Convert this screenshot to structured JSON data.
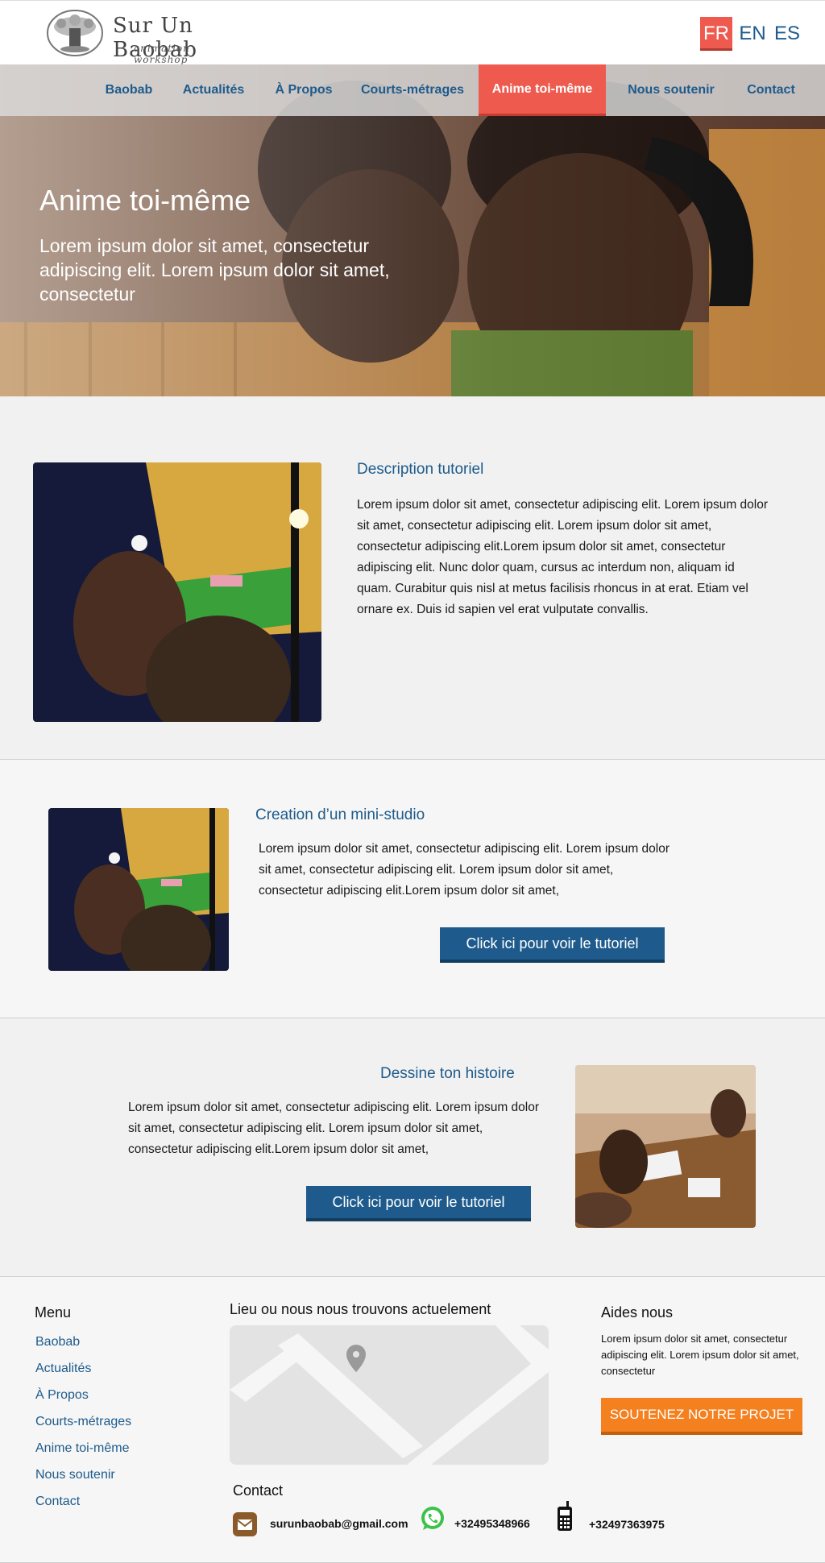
{
  "header": {
    "logo_title": "Sur Un Baobab",
    "logo_subtitle": "animation workshop",
    "languages": [
      {
        "label": "FR",
        "active": true
      },
      {
        "label": "EN",
        "active": false
      },
      {
        "label": "ES",
        "active": false
      }
    ]
  },
  "nav": {
    "items": [
      {
        "label": "Baobab"
      },
      {
        "label": "Actualités"
      },
      {
        "label": "À Propos"
      },
      {
        "label": "Courts-métrages"
      },
      {
        "label": "Anime toi-même",
        "active": true
      },
      {
        "label": "Nous soutenir"
      },
      {
        "label": "Contact"
      }
    ]
  },
  "hero": {
    "title": "Anime toi-même",
    "text": "Lorem ipsum dolor sit amet, consectetur adipiscing elit. Lorem ipsum dolor sit amet, consectetur"
  },
  "section1": {
    "title": "Description tutoriel",
    "text": "Lorem ipsum dolor sit amet, consectetur adipiscing elit. Lorem ipsum dolor sit amet, consectetur adipiscing elit. Lorem ipsum dolor sit amet, consectetur adipiscing elit.Lorem ipsum dolor sit amet, consectetur adipiscing elit. Nunc dolor quam, cursus ac interdum non, aliquam id quam. Curabitur quis nisl at metus facilisis rhoncus in at erat. Etiam vel ornare ex. Duis id sapien vel erat vulputate convallis."
  },
  "section2": {
    "title": "Creation d’un mini-studio",
    "text": "Lorem ipsum dolor sit amet, consectetur adipiscing elit. Lorem ipsum dolor sit amet, consectetur adipiscing elit. Lorem ipsum dolor sit amet, consectetur adipiscing elit.Lorem ipsum dolor sit amet,",
    "button": "Click ici pour voir le tutoriel"
  },
  "section3": {
    "title": "Dessine ton histoire",
    "text": "Lorem ipsum dolor sit amet, consectetur adipiscing elit. Lorem ipsum dolor sit amet, consectetur adipiscing elit. Lorem ipsum dolor sit amet, consectetur adipiscing elit.Lorem ipsum dolor sit amet,",
    "button": "Click ici pour voir le tutoriel"
  },
  "footer": {
    "menu_heading": "Menu",
    "menu_items": [
      "Baobab",
      "Actualités",
      "À Propos",
      "Courts-métrages",
      "Anime toi-même",
      "Nous soutenir",
      "Contact"
    ],
    "location_heading": "Lieu ou nous nous trouvons actuelement",
    "contact_heading": "Contact",
    "email": "surunbaobab@gmail.com",
    "whatsapp": "+32495348966",
    "phone": "+32497363975",
    "aid_heading": "Aides nous",
    "aid_text": "Lorem ipsum dolor sit amet, consectetur adipiscing elit. Lorem ipsum dolor sit amet, consectetur",
    "cta": "SOUTENEZ NOTRE PROJET"
  },
  "colors": {
    "accent_red": "#ef5a4f",
    "link_blue": "#1e5b8c",
    "cta_orange": "#f4801f",
    "whatsapp_green": "#3cc24a",
    "mail_brown": "#8b5a2b"
  },
  "icons": [
    "baobab-logo-icon",
    "map-pin-icon",
    "mail-icon",
    "whatsapp-icon",
    "mobile-phone-icon"
  ]
}
